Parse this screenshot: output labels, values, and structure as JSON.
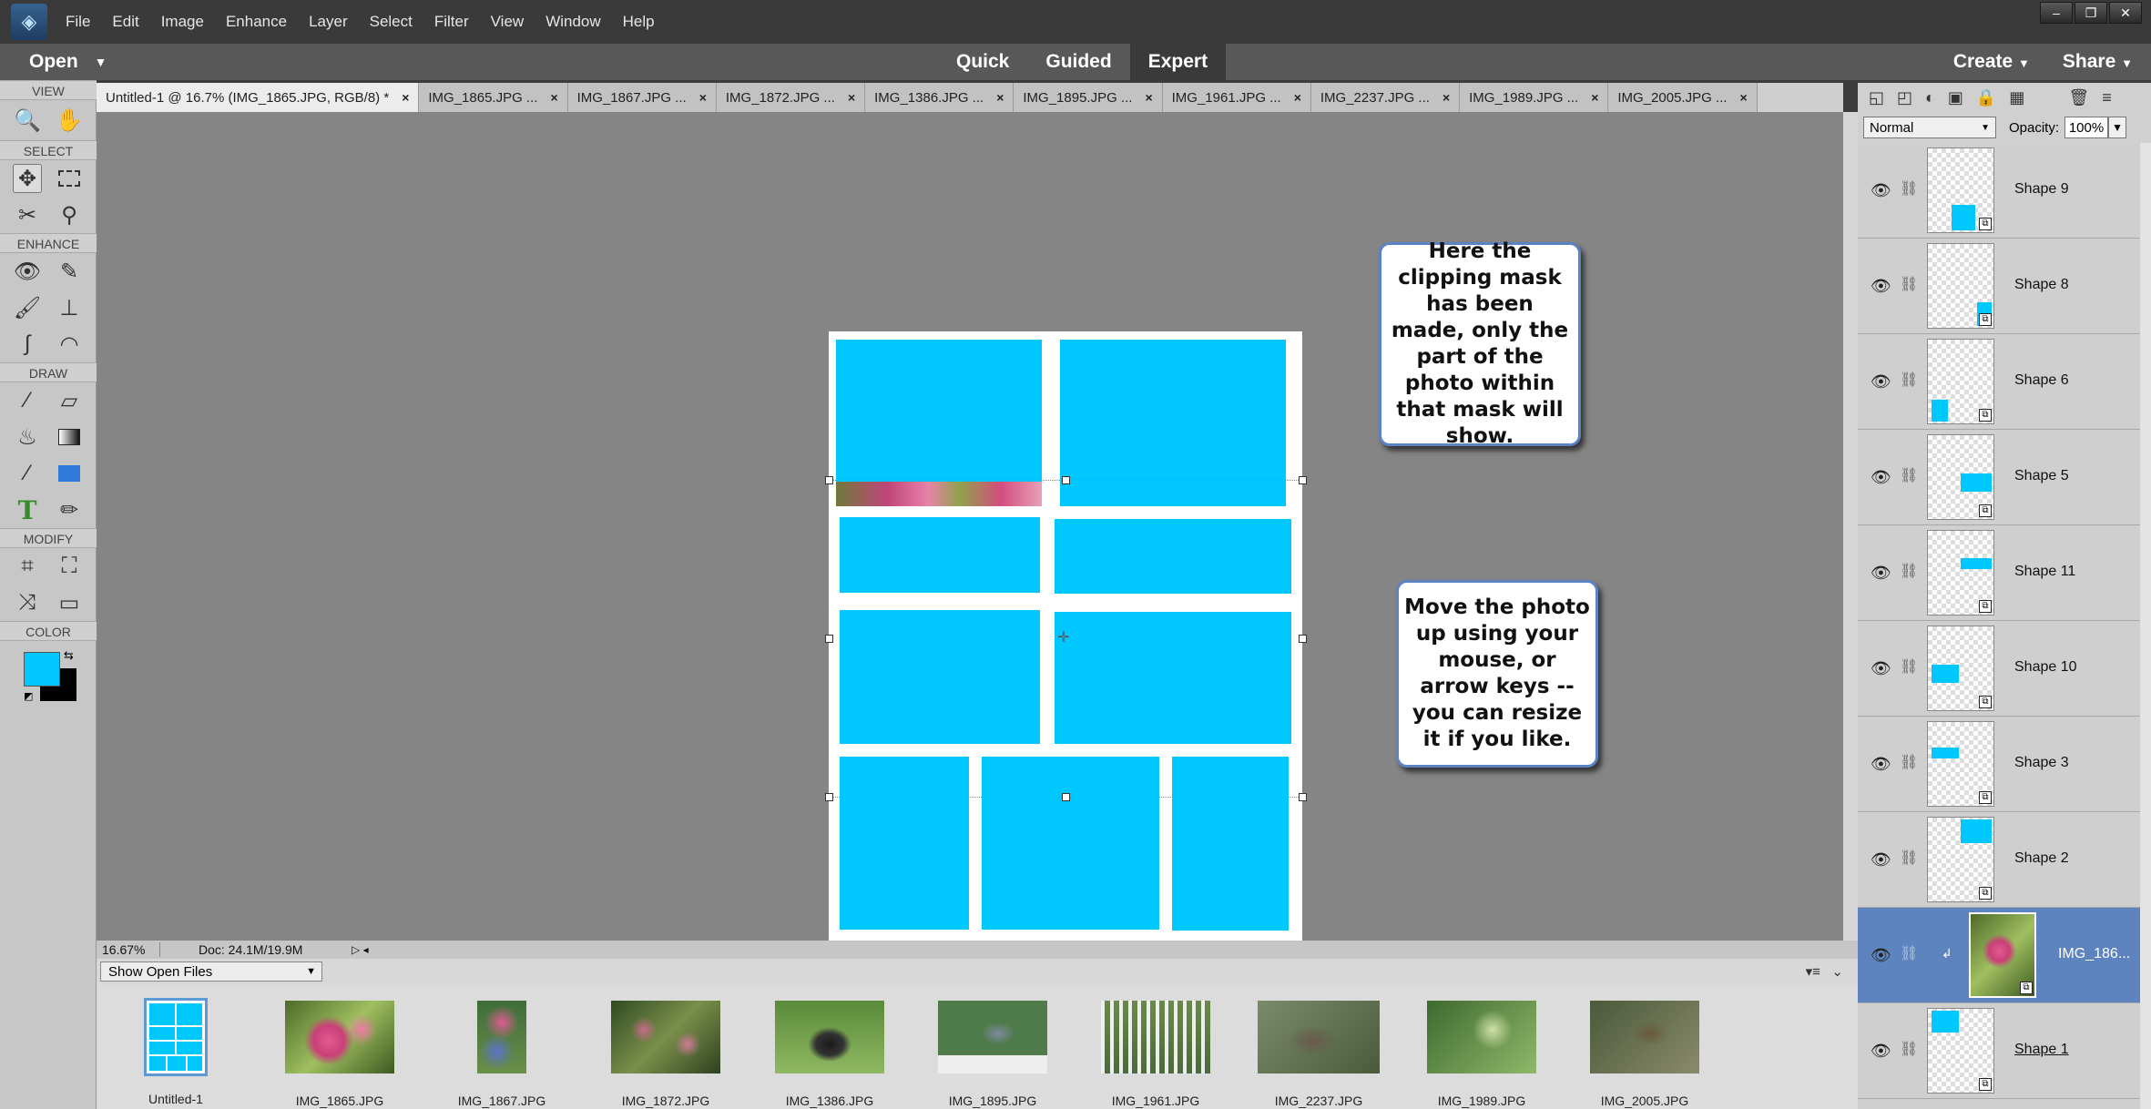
{
  "menu": {
    "items": [
      "File",
      "Edit",
      "Image",
      "Enhance",
      "Layer",
      "Select",
      "Filter",
      "View",
      "Window",
      "Help"
    ],
    "window_controls": [
      "–",
      "❐",
      "✕"
    ]
  },
  "modebar": {
    "open": "Open",
    "modes": [
      "Quick",
      "Guided",
      "Expert"
    ],
    "active_mode": "Expert",
    "create": "Create",
    "share": "Share"
  },
  "toolbox": {
    "sections": [
      "VIEW",
      "SELECT",
      "ENHANCE",
      "DRAW",
      "MODIFY",
      "COLOR"
    ]
  },
  "tabs": [
    "Untitled-1 @ 16.7% (IMG_1865.JPG, RGB/8) *",
    "IMG_1865.JPG ...",
    "IMG_1867.JPG ...",
    "IMG_1872.JPG ...",
    "IMG_1386.JPG ...",
    "IMG_1895.JPG ...",
    "IMG_1961.JPG ...",
    "IMG_2237.JPG ...",
    "IMG_1989.JPG ...",
    "IMG_2005.JPG ..."
  ],
  "tab_close": "×",
  "callouts": {
    "first": "Here the clipping mask has been made, only the part of the photo within that mask will show.",
    "second": "Move the photo up using your mouse, or arrow keys -- you can resize it if you like."
  },
  "status": {
    "zoom": "16.67%",
    "doc": "Doc: 24.1M/19.9M"
  },
  "bin": {
    "dropdown": "Show Open Files",
    "thumbs": [
      "Untitled-1",
      "IMG_1865.JPG",
      "IMG_1867.JPG",
      "IMG_1872.JPG",
      "IMG_1386.JPG",
      "IMG_1895.JPG",
      "IMG_1961.JPG",
      "IMG_2237.JPG",
      "IMG_1989.JPG",
      "IMG_2005.JPG"
    ]
  },
  "layers_panel": {
    "blend_mode": "Normal",
    "opacity_label": "Opacity:",
    "opacity_value": "100%",
    "layers": [
      "Shape 9",
      "Shape 8",
      "Shape 6",
      "Shape 5",
      "Shape 11",
      "Shape 10",
      "Shape 3",
      "Shape 2",
      "IMG_186...",
      "Shape 1"
    ],
    "active_layer": "IMG_186..."
  },
  "colors": {
    "shape_fill": "#00c8ff",
    "canvas_bg": "#858585",
    "active_layer": "#5d84be",
    "foreground": "#00c8ff",
    "background": "#000000"
  }
}
